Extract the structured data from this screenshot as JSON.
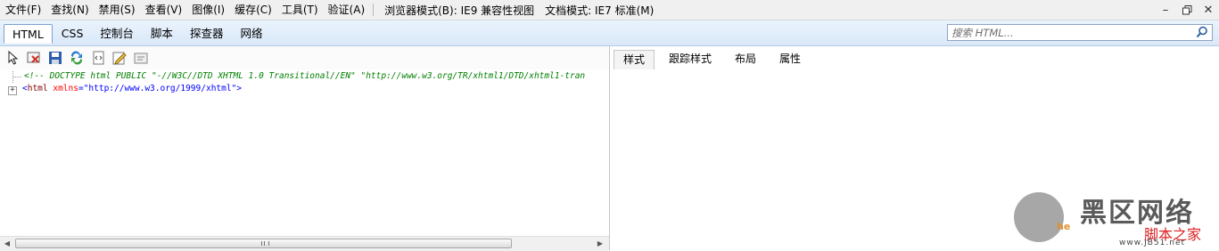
{
  "menubar": {
    "items": [
      "文件(F)",
      "查找(N)",
      "禁用(S)",
      "查看(V)",
      "图像(I)",
      "缓存(C)",
      "工具(T)",
      "验证(A)"
    ],
    "browser_mode": "浏览器模式(B): IE9 兼容性视图",
    "document_mode": "文档模式: IE7 标准(M)"
  },
  "tabs": [
    {
      "label": "HTML",
      "active": true
    },
    {
      "label": "CSS"
    },
    {
      "label": "控制台"
    },
    {
      "label": "脚本"
    },
    {
      "label": "探查器"
    },
    {
      "label": "网络"
    }
  ],
  "search": {
    "placeholder": "搜索 HTML..."
  },
  "toolbar_icons": [
    "select-element-icon",
    "clear-outline-icon",
    "save-icon",
    "refresh-icon",
    "word-wrap-icon",
    "edit-icon",
    "dom-source-icon"
  ],
  "tree": {
    "doctype": "<!-- DOCTYPE html PUBLIC \"-//W3C//DTD XHTML 1.0 Transitional//EN\" \"http://www.w3.org/TR/xhtml1/DTD/xhtml1-tran",
    "html_tag": "html",
    "html_attr": "xmlns",
    "html_value": "\"http://www.w3.org/1999/xhtml\""
  },
  "right_tabs": [
    {
      "label": "样式",
      "active": true
    },
    {
      "label": "跟踪样式"
    },
    {
      "label": "布局"
    },
    {
      "label": "属性"
    }
  ],
  "watermark": {
    "brand": "黑区网络",
    "tagline": "脚本之家",
    "url": "www.JB51.net",
    "partial": "he"
  }
}
